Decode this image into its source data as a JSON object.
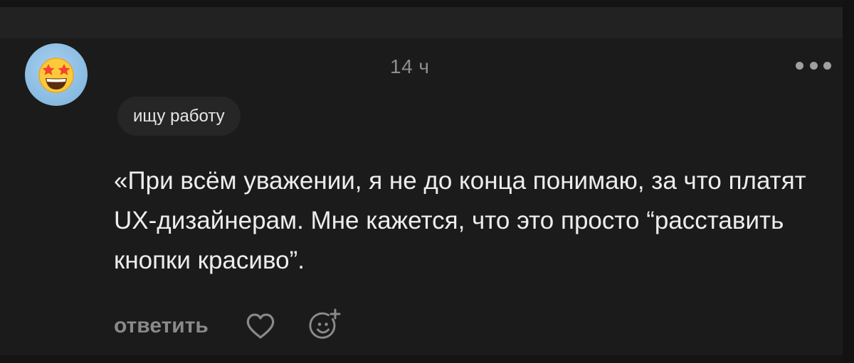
{
  "comment": {
    "timestamp": "14 ч",
    "status_badge": "ищу работу",
    "text": "«При всём уважении, я не до конца понимаю, за что платят UX-дизайнерам. Мне кажется, что это просто “расставить кнопки красиво”.",
    "avatar_icon": "star-struck-emoji-icon",
    "avatar_bg": "#8cbde3"
  },
  "actions": {
    "reply_label": "ответить",
    "like_icon": "heart-outline-icon",
    "react_icon": "add-reaction-icon",
    "more_icon": "more-dots-icon"
  },
  "colors": {
    "background": "#1b1b1b",
    "text": "#ededed",
    "muted": "#8a8a8a",
    "badge_bg": "#262626"
  }
}
